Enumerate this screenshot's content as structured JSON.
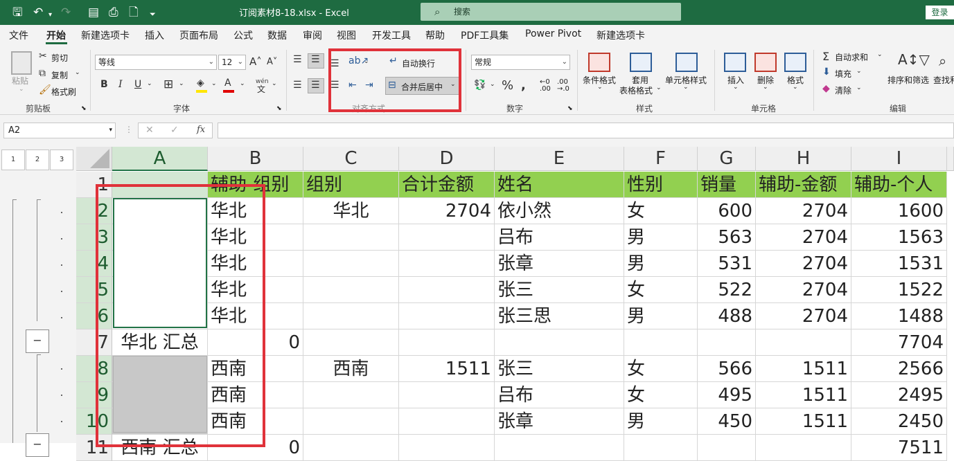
{
  "titlebar": {
    "title": "订阅素材8-18.xlsx  -  Excel",
    "search_placeholder": "搜索",
    "login": "登录"
  },
  "menu": [
    "文件",
    "开始",
    "新建选项卡",
    "插入",
    "页面布局",
    "公式",
    "数据",
    "审阅",
    "视图",
    "开发工具",
    "帮助",
    "PDF工具集",
    "Power Pivot",
    "新建选项卡"
  ],
  "ribbon": {
    "clipboard": {
      "paste": "粘贴",
      "cut": "剪切",
      "copy": "复制",
      "format_painter": "格式刷",
      "label": "剪贴板"
    },
    "font": {
      "name": "等线",
      "size": "12",
      "label": "字体",
      "wen": "wén",
      "bold": "B",
      "italic": "I",
      "underline": "U"
    },
    "alignment": {
      "wrap": "自动换行",
      "merge": "合并后居中",
      "label": "对齐方式"
    },
    "number": {
      "format": "常规",
      "label": "数字",
      "percent": "%"
    },
    "styles": {
      "cond": "条件格式",
      "table": "套用",
      "table2": "表格格式",
      "cell": "单元格样式",
      "label": "样式"
    },
    "cells": {
      "insert": "插入",
      "delete": "删除",
      "format": "格式",
      "label": "单元格"
    },
    "editing": {
      "autosum": "自动求和",
      "fill": "填充",
      "clear": "清除",
      "sort": "排序和筛选",
      "find": "查找和",
      "label": "编辑"
    }
  },
  "formula_bar": {
    "name_box": "A2",
    "fx": "fx",
    "cancel": "✕",
    "enter": "✓"
  },
  "levels": [
    "1",
    "2",
    "3"
  ],
  "columns": [
    "A",
    "B",
    "C",
    "D",
    "E",
    "F",
    "G",
    "H",
    "I"
  ],
  "rows": [
    {
      "n": "1",
      "cells": [
        "",
        "辅助-组别",
        "组别",
        "合计金额",
        "姓名",
        "性别",
        "销量",
        "辅助-金额",
        "辅助-个人"
      ]
    },
    {
      "n": "2",
      "cells": [
        "",
        "华北",
        "华北",
        "2704",
        "依小然",
        "女",
        "600",
        "2704",
        "1600"
      ]
    },
    {
      "n": "3",
      "cells": [
        "",
        "华北",
        "",
        "",
        "吕布",
        "男",
        "563",
        "2704",
        "1563"
      ]
    },
    {
      "n": "4",
      "cells": [
        "",
        "华北",
        "",
        "",
        "张章",
        "男",
        "531",
        "2704",
        "1531"
      ]
    },
    {
      "n": "5",
      "cells": [
        "",
        "华北",
        "",
        "",
        "张三",
        "女",
        "522",
        "2704",
        "1522"
      ]
    },
    {
      "n": "6",
      "cells": [
        "",
        "华北",
        "",
        "",
        "张三思",
        "男",
        "488",
        "2704",
        "1488"
      ]
    },
    {
      "n": "7",
      "cells": [
        "华北 汇总",
        "0",
        "",
        "",
        "",
        "",
        "",
        "",
        "7704"
      ]
    },
    {
      "n": "8",
      "cells": [
        "",
        "西南",
        "西南",
        "1511",
        "张三",
        "女",
        "566",
        "1511",
        "2566"
      ]
    },
    {
      "n": "9",
      "cells": [
        "",
        "西南",
        "",
        "",
        "吕布",
        "女",
        "495",
        "1511",
        "2495"
      ]
    },
    {
      "n": "10",
      "cells": [
        "",
        "西南",
        "",
        "",
        "张章",
        "男",
        "450",
        "1511",
        "2450"
      ]
    },
    {
      "n": "11",
      "cells": [
        "西南 汇总",
        "0",
        "",
        "",
        "",
        "",
        "",
        "",
        "7511"
      ]
    }
  ],
  "colors": {
    "accent": "#1e6b41",
    "header_fill": "#92d050",
    "highlight": "#e0323a",
    "merged_fill": "#c8c8c8"
  }
}
